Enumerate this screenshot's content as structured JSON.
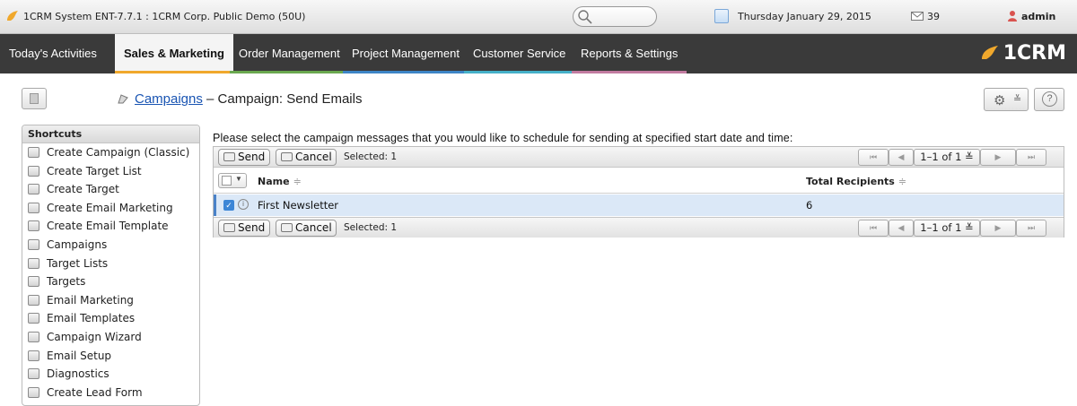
{
  "topbar": {
    "title": "1CRM System ENT-7.7.1 : 1CRM Corp. Public Demo (50U)",
    "date": "Thursday January 29, 2015",
    "mail_count": "39",
    "user": "admin"
  },
  "nav": {
    "tabs": [
      {
        "label": "Today's Activities",
        "color": "#3a3a3a"
      },
      {
        "label": "Sales & Marketing",
        "color": "#f0a82c"
      },
      {
        "label": "Order Management",
        "color": "#6aa84f"
      },
      {
        "label": "Project Management",
        "color": "#3d85c6"
      },
      {
        "label": "Customer Service",
        "color": "#45b0c8"
      },
      {
        "label": "Reports & Settings",
        "color": "#c27ba0"
      }
    ],
    "active_index": 1,
    "brand": "1CRM"
  },
  "page": {
    "breadcrumb_link": "Campaigns",
    "breadcrumb_rest": "– Campaign: Send Emails"
  },
  "sidebar": {
    "header": "Shortcuts",
    "items": [
      {
        "label": "Create Campaign (Classic)"
      },
      {
        "label": "Create Target List"
      },
      {
        "label": "Create Target"
      },
      {
        "label": "Create Email Marketing"
      },
      {
        "label": "Create Email Template"
      },
      {
        "label": "Campaigns"
      },
      {
        "label": "Target Lists"
      },
      {
        "label": "Targets"
      },
      {
        "label": "Email Marketing"
      },
      {
        "label": "Email Templates"
      },
      {
        "label": "Campaign Wizard"
      },
      {
        "label": "Email Setup"
      },
      {
        "label": "Diagnostics"
      },
      {
        "label": "Create Lead Form"
      }
    ]
  },
  "main": {
    "instruction": "Please select the campaign messages that you would like to schedule for sending at specified start date and time:",
    "toolbar": {
      "send_label": "Send",
      "cancel_label": "Cancel",
      "selected_text": "Selected: 1",
      "page_range": "1–1 of 1 ≚",
      "first_glyph": "⏮",
      "prev_glyph": "◀",
      "next_glyph": "▶",
      "last_glyph": "⏭"
    },
    "columns": {
      "name": "Name",
      "total": "Total Recipients",
      "sort_glyph": "≑"
    },
    "rows": [
      {
        "name": "First Newsletter",
        "total": "6",
        "checked": true
      }
    ]
  }
}
